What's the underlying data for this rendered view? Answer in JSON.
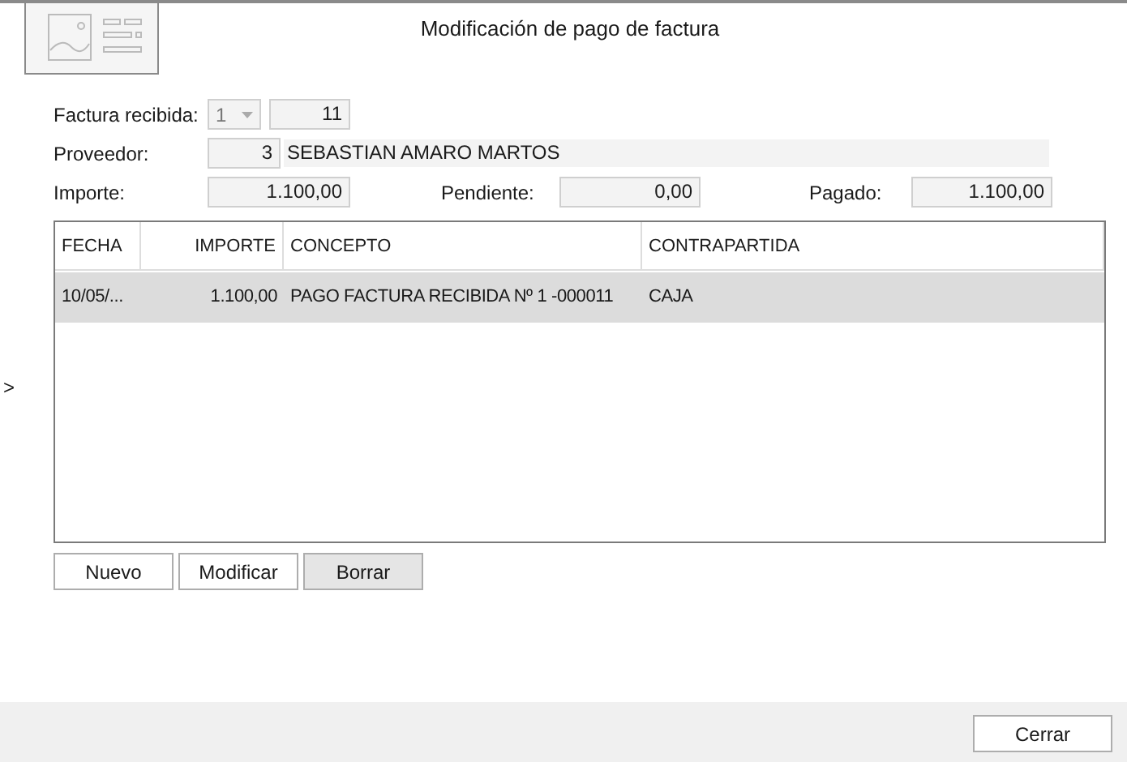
{
  "window": {
    "title": "Modificación de pago de factura"
  },
  "form": {
    "factura_label": "Factura recibida:",
    "serie": "1",
    "numero": "11",
    "proveedor_label": "Proveedor:",
    "proveedor_code": "3",
    "proveedor_name": "SEBASTIAN AMARO MARTOS",
    "importe_label": "Importe:",
    "importe": "1.100,00",
    "pendiente_label": "Pendiente:",
    "pendiente": "0,00",
    "pagado_label": "Pagado:",
    "pagado": "1.100,00"
  },
  "side_toggle": ">",
  "table": {
    "columns": [
      "FECHA",
      "IMPORTE",
      "CONCEPTO",
      "CONTRAPARTIDA"
    ],
    "rows": [
      {
        "cells": [
          "10/05/...",
          "1.100,00",
          "PAGO FACTURA RECIBIDA Nº 1 -000011",
          "CAJA"
        ],
        "selected": true
      }
    ]
  },
  "buttons": [
    {
      "label": "Nuevo",
      "focused": false
    },
    {
      "label": "Modificar",
      "focused": false
    },
    {
      "label": "Borrar",
      "focused": true
    }
  ],
  "close_button": "Cerrar"
}
